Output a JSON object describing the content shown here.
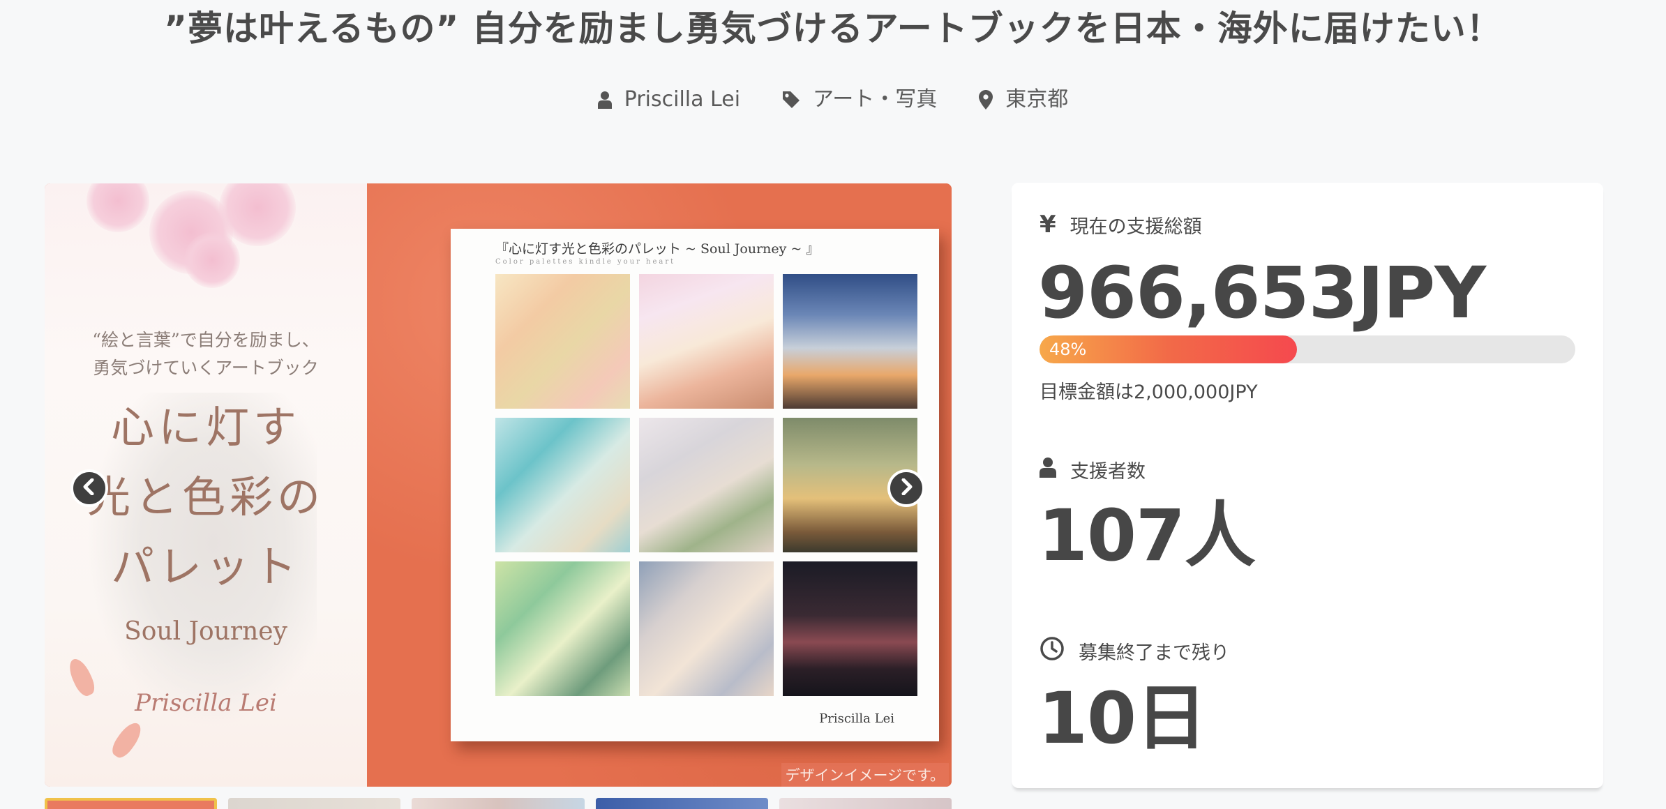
{
  "project": {
    "title": "”夢は叶えるもの” 自分を励まし勇気づけるアートブックを日本・海外に届けたい！",
    "owner": "Priscilla Lei",
    "category": "アート・写真",
    "location": "東京都"
  },
  "carousel": {
    "cover_subtitle_line1": "“絵と言葉”で自分を励まし、",
    "cover_subtitle_line2": "勇気づけていくアートブック",
    "cover_title_line1": "心に灯す",
    "cover_title_line2": "光と色彩の",
    "cover_title_line3": "パレット",
    "cover_english": "Soul Journey",
    "cover_signature": "Priscilla Lei",
    "book_title": "『心に灯す光と色彩のパレット ~ Soul Journey ~ 』",
    "book_tagline": "Color palettes kindle your heart",
    "book_author": "Priscilla Lei",
    "design_note": "デザインイメージです。",
    "active_index": 0,
    "thumbnail_count": 5
  },
  "stats": {
    "amount_label": "現在の支援総額",
    "amount_value": "966,653JPY",
    "progress_percent": 48,
    "progress_label": "48%",
    "goal_text": "目標金額は2,000,000JPY",
    "supporters_label": "支援者数",
    "supporters_value": "107人",
    "remaining_label": "募集終了まで残り",
    "remaining_value": "10日"
  },
  "colors": {
    "progress_start": "#f7a84a",
    "progress_end": "#f5494e",
    "progress_track": "#e6e6e6",
    "text_primary": "#474747",
    "cover_background": "#e5704f"
  },
  "icons": {
    "owner": "user-icon",
    "category": "tag-icon",
    "location": "map-pin-icon",
    "amount": "yen-icon",
    "supporters": "user-icon",
    "remaining": "clock-icon",
    "prev": "chevron-left-icon",
    "next": "chevron-right-icon"
  }
}
